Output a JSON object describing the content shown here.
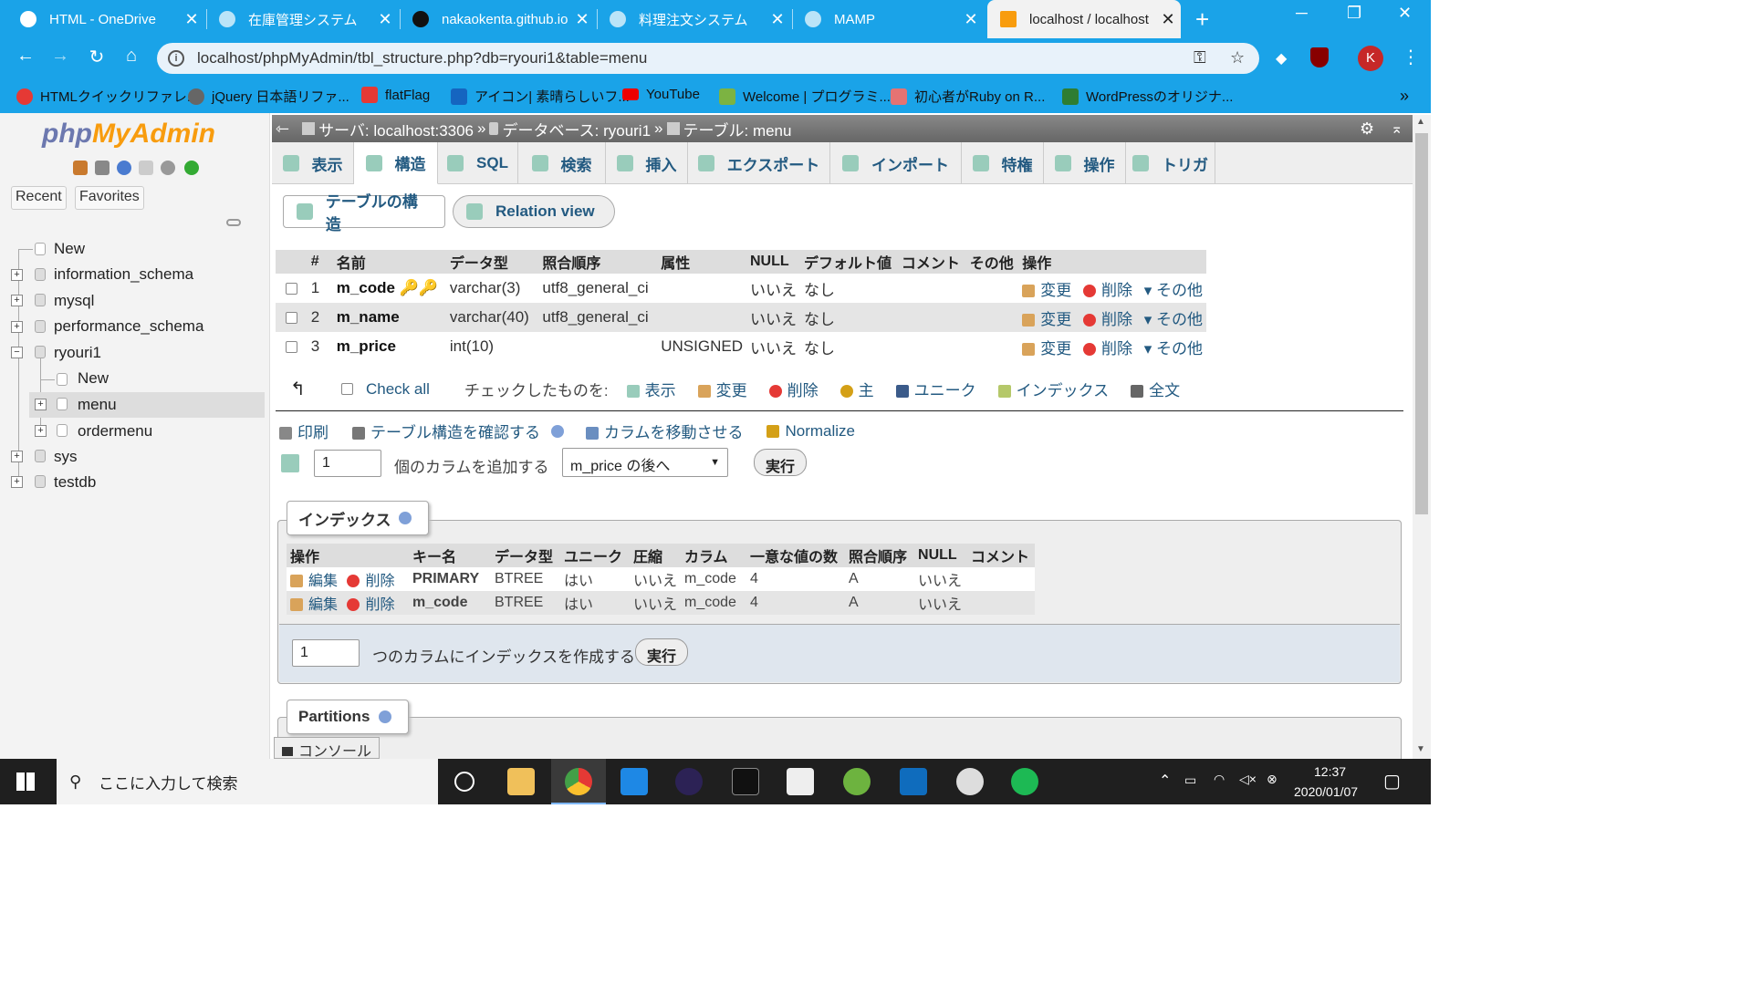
{
  "browser": {
    "tabs": [
      {
        "title": "HTML - OneDrive"
      },
      {
        "title": "在庫管理システム"
      },
      {
        "title": "nakaokenta.github.io"
      },
      {
        "title": "料理注文システム"
      },
      {
        "title": "MAMP"
      },
      {
        "title": "localhost / localhost"
      }
    ],
    "url": "localhost/phpMyAdmin/tbl_structure.php?db=ryouri1&table=menu",
    "profile_initial": "K",
    "bookmarks": [
      "HTMLクイックリファレ...",
      "jQuery 日本語リファ...",
      "flatFlag",
      "アイコン| 素晴らしいフ...",
      "YouTube",
      "Welcome | プログラミ...",
      "初心者がRuby on R...",
      "WordPressのオリジナ..."
    ],
    "more_bookmarks": "»"
  },
  "nav": {
    "logo_a": "php",
    "logo_b": "MyAdmin",
    "recent": "Recent",
    "favorites": "Favorites",
    "tree": [
      "New",
      "information_schema",
      "mysql",
      "performance_schema",
      "ryouri1",
      "New",
      "menu",
      "ordermenu",
      "sys",
      "testdb"
    ]
  },
  "breadcrumb": {
    "server": "サーバ: localhost:3306",
    "sep": "»",
    "database": "データベース: ryouri1",
    "table": "テーブル: menu"
  },
  "tabs": [
    "表示",
    "構造",
    "SQL",
    "検索",
    "挿入",
    "エクスポート",
    "インポート",
    "特権",
    "操作",
    "トリガ"
  ],
  "subtabs": [
    "テーブルの構造",
    "Relation view"
  ],
  "structure": {
    "headers": [
      "#",
      "名前",
      "データ型",
      "照合順序",
      "属性",
      "NULL",
      "デフォルト値",
      "コメント",
      "その他",
      "操作"
    ],
    "rows": [
      {
        "num": "1",
        "name": "m_code",
        "type": "varchar(3)",
        "collation": "utf8_general_ci",
        "attr": "",
        "null": "いいえ",
        "default": "なし"
      },
      {
        "num": "2",
        "name": "m_name",
        "type": "varchar(40)",
        "collation": "utf8_general_ci",
        "attr": "",
        "null": "いいえ",
        "default": "なし"
      },
      {
        "num": "3",
        "name": "m_price",
        "type": "int(10)",
        "collation": "",
        "attr": "UNSIGNED",
        "null": "いいえ",
        "default": "なし"
      }
    ],
    "actions": {
      "change": "変更",
      "drop": "削除",
      "more": "その他"
    }
  },
  "bulk": {
    "check_all": "Check all",
    "with_selected": "チェックしたものを:",
    "items": [
      "表示",
      "変更",
      "削除",
      "主",
      "ユニーク",
      "インデックス",
      "全文"
    ]
  },
  "links": {
    "print": "印刷",
    "propose": "テーブル構造を確認する",
    "move": "カラムを移動させる",
    "normalize": "Normalize"
  },
  "add_columns": {
    "count": "1",
    "label": "個のカラムを追加する",
    "position": "m_price の後へ",
    "go": "実行"
  },
  "indexes": {
    "legend": "インデックス",
    "headers": [
      "操作",
      "キー名",
      "データ型",
      "ユニーク",
      "圧縮",
      "カラム",
      "一意な値の数",
      "照合順序",
      "NULL",
      "コメント"
    ],
    "edit": "編集",
    "drop": "削除",
    "rows": [
      {
        "key": "PRIMARY",
        "type": "BTREE",
        "unique": "はい",
        "packed": "いいえ",
        "column": "m_code",
        "cardinality": "4",
        "collation": "A",
        "null": "いいえ",
        "comment": ""
      },
      {
        "key": "m_code",
        "type": "BTREE",
        "unique": "はい",
        "packed": "いいえ",
        "column": "m_code",
        "cardinality": "4",
        "collation": "A",
        "null": "いいえ",
        "comment": ""
      }
    ],
    "create_count": "1",
    "create_label": "つのカラムにインデックスを作成する",
    "go": "実行"
  },
  "partitions": {
    "legend": "Partitions"
  },
  "console": "コンソール",
  "taskbar": {
    "search_placeholder": "ここに入力して検索",
    "time": "12:37",
    "date": "2020/01/07"
  }
}
